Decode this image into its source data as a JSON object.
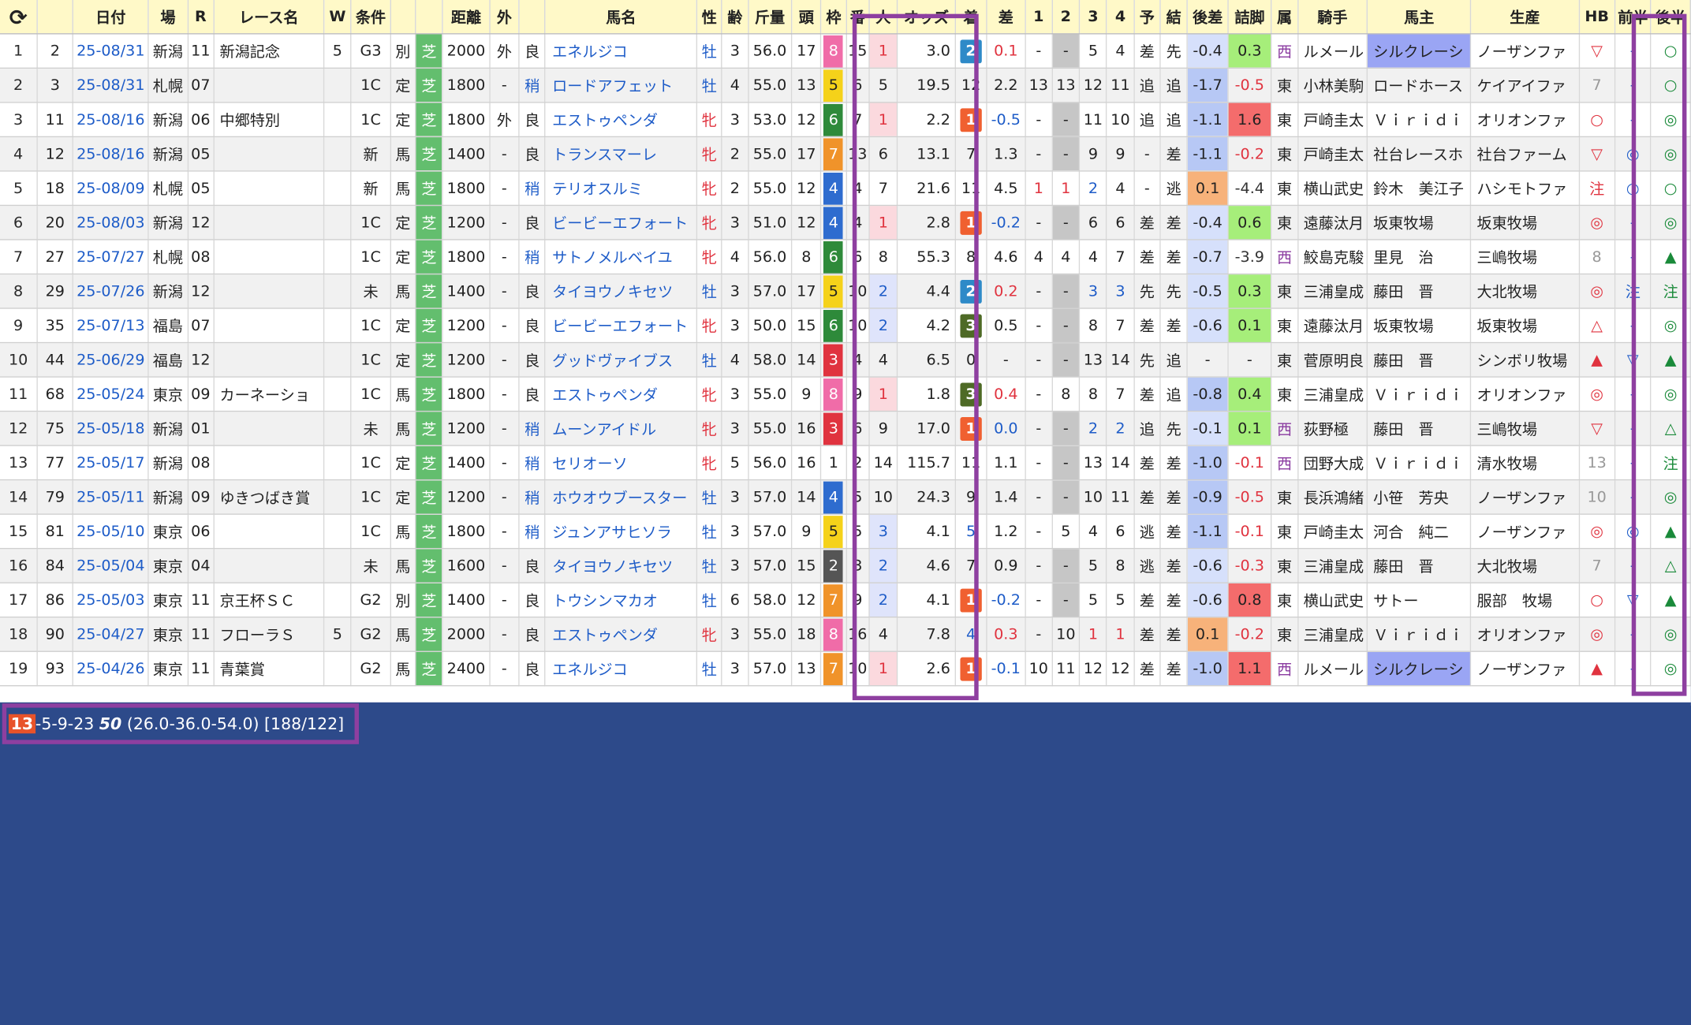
{
  "headers": [
    "⟳",
    "",
    "日付",
    "場",
    "R",
    "レース名",
    "W",
    "条件",
    "",
    "",
    "距離",
    "外",
    "",
    "馬名",
    "性",
    "齢",
    "斤量",
    "頭",
    "枠",
    "番",
    "人",
    "オッズ",
    "着",
    "差",
    "1",
    "2",
    "3",
    "4",
    "予",
    "結",
    "後差",
    "詰脚",
    "属",
    "騎手",
    "馬主",
    "生産",
    "HB",
    "前半",
    "後半"
  ],
  "colors": {
    "header_bg": "#fff9c8",
    "highlight_border": "#8e3fa0",
    "page_bg": "#2d4a8a",
    "turf": "#63be6e",
    "finish1": "#f06030",
    "finish2": "#2e8ac8",
    "finish3": "#4e6a26",
    "owner_highlight": "#9aa5f4"
  },
  "rows": [
    {
      "no": "1",
      "a": "2",
      "date": "25-08/31",
      "venue": "新潟",
      "r": "11",
      "race": "新潟記念",
      "w": "5",
      "cls": "G3",
      "cond": "別",
      "surface": "芝",
      "dist": "2000",
      "out": "外",
      "going": "良",
      "horse": "エネルジコ",
      "sex": "牡",
      "age": "3",
      "wt": "56.0",
      "heads": "17",
      "gate": "8",
      "num": "15",
      "pop": "1",
      "odds": "3.0",
      "fin": "2",
      "diff": "0.1",
      "c1": "-",
      "c2": "-",
      "c3": "5",
      "c4": "4",
      "yo": "差",
      "ke": "先",
      "late": "-0.4",
      "tsume": "0.3",
      "zoku": "西",
      "jockey": "ルメール",
      "owner": "シルクレーシ",
      "breeder": "ノーザンファ",
      "hb": "▽",
      "zen": "-",
      "kou": "○"
    },
    {
      "no": "2",
      "a": "3",
      "date": "25-08/31",
      "venue": "札幌",
      "r": "07",
      "race": "",
      "w": "",
      "cls": "1C",
      "cond": "定",
      "surface": "芝",
      "dist": "1800",
      "out": "-",
      "going": "稍",
      "horse": "ロードアフェット",
      "sex": "牡",
      "age": "4",
      "wt": "55.0",
      "heads": "13",
      "gate": "5",
      "num": "6",
      "pop": "5",
      "odds": "19.5",
      "fin": "12",
      "diff": "2.2",
      "c1": "13",
      "c2": "13",
      "c3": "12",
      "c4": "11",
      "yo": "追",
      "ke": "追",
      "late": "-1.7",
      "tsume": "-0.5",
      "zoku": "東",
      "jockey": "小林美駒",
      "owner": "ロードホース",
      "breeder": "ケイアイファ",
      "hb": "7",
      "zen": "-",
      "kou": "○"
    },
    {
      "no": "3",
      "a": "11",
      "date": "25-08/16",
      "venue": "新潟",
      "r": "06",
      "race": "中郷特別",
      "w": "",
      "cls": "1C",
      "cond": "定",
      "surface": "芝",
      "dist": "1800",
      "out": "外",
      "going": "良",
      "horse": "エストゥペンダ",
      "sex": "牝",
      "age": "3",
      "wt": "53.0",
      "heads": "12",
      "gate": "6",
      "num": "7",
      "pop": "1",
      "odds": "2.2",
      "fin": "1",
      "diff": "-0.5",
      "c1": "-",
      "c2": "-",
      "c3": "11",
      "c4": "10",
      "yo": "追",
      "ke": "追",
      "late": "-1.1",
      "tsume": "1.6",
      "zoku": "東",
      "jockey": "戸崎圭太",
      "owner": "Ｖｉｒｉｄｉ",
      "breeder": "オリオンファ",
      "hb": "○",
      "zen": "-",
      "kou": "◎"
    },
    {
      "no": "4",
      "a": "12",
      "date": "25-08/16",
      "venue": "新潟",
      "r": "05",
      "race": "",
      "w": "",
      "cls": "新",
      "cond": "馬",
      "surface": "芝",
      "dist": "1400",
      "out": "-",
      "going": "良",
      "horse": "トランスマーレ",
      "sex": "牝",
      "age": "2",
      "wt": "55.0",
      "heads": "17",
      "gate": "7",
      "num": "13",
      "pop": "6",
      "odds": "13.1",
      "fin": "7",
      "diff": "1.3",
      "c1": "-",
      "c2": "-",
      "c3": "9",
      "c4": "9",
      "yo": "-",
      "ke": "差",
      "late": "-1.1",
      "tsume": "-0.2",
      "zoku": "東",
      "jockey": "戸崎圭太",
      "owner": "社台レースホ",
      "breeder": "社台ファーム",
      "hb": "▽",
      "zen": "◎",
      "kou": "◎"
    },
    {
      "no": "5",
      "a": "18",
      "date": "25-08/09",
      "venue": "札幌",
      "r": "05",
      "race": "",
      "w": "",
      "cls": "新",
      "cond": "馬",
      "surface": "芝",
      "dist": "1800",
      "out": "-",
      "going": "稍",
      "horse": "テリオスルミ",
      "sex": "牝",
      "age": "2",
      "wt": "55.0",
      "heads": "12",
      "gate": "4",
      "num": "4",
      "pop": "7",
      "odds": "21.6",
      "fin": "11",
      "diff": "4.5",
      "c1": "1",
      "c2": "1",
      "c3": "2",
      "c4": "4",
      "yo": "-",
      "ke": "逃",
      "late": "0.1",
      "tsume": "-4.4",
      "zoku": "東",
      "jockey": "横山武史",
      "owner": "鈴木　美江子",
      "breeder": "ハシモトファ",
      "hb": "注",
      "zen": "○",
      "kou": "○"
    },
    {
      "no": "6",
      "a": "20",
      "date": "25-08/03",
      "venue": "新潟",
      "r": "12",
      "race": "",
      "w": "",
      "cls": "1C",
      "cond": "定",
      "surface": "芝",
      "dist": "1200",
      "out": "-",
      "going": "良",
      "horse": "ビービーエフォート",
      "sex": "牝",
      "age": "3",
      "wt": "51.0",
      "heads": "12",
      "gate": "4",
      "num": "4",
      "pop": "1",
      "odds": "2.8",
      "fin": "1",
      "diff": "-0.2",
      "c1": "-",
      "c2": "-",
      "c3": "6",
      "c4": "6",
      "yo": "差",
      "ke": "差",
      "late": "-0.4",
      "tsume": "0.6",
      "zoku": "東",
      "jockey": "遠藤汰月",
      "owner": "坂東牧場",
      "breeder": "坂東牧場",
      "hb": "◎",
      "zen": "-",
      "kou": "◎"
    },
    {
      "no": "7",
      "a": "27",
      "date": "25-07/27",
      "venue": "札幌",
      "r": "08",
      "race": "",
      "w": "",
      "cls": "1C",
      "cond": "定",
      "surface": "芝",
      "dist": "1800",
      "out": "-",
      "going": "稍",
      "horse": "サトノメルベイユ",
      "sex": "牝",
      "age": "4",
      "wt": "56.0",
      "heads": "8",
      "gate": "6",
      "num": "6",
      "pop": "8",
      "odds": "55.3",
      "fin": "8",
      "diff": "4.6",
      "c1": "4",
      "c2": "4",
      "c3": "4",
      "c4": "7",
      "yo": "差",
      "ke": "差",
      "late": "-0.7",
      "tsume": "-3.9",
      "zoku": "西",
      "jockey": "鮫島克駿",
      "owner": "里見　治",
      "breeder": "三嶋牧場",
      "hb": "8",
      "zen": "-",
      "kou": "▲"
    },
    {
      "no": "8",
      "a": "29",
      "date": "25-07/26",
      "venue": "新潟",
      "r": "12",
      "race": "",
      "w": "",
      "cls": "未",
      "cond": "馬",
      "surface": "芝",
      "dist": "1400",
      "out": "-",
      "going": "良",
      "horse": "タイヨウノキセツ",
      "sex": "牡",
      "age": "3",
      "wt": "57.0",
      "heads": "17",
      "gate": "5",
      "num": "10",
      "pop": "2",
      "odds": "4.4",
      "fin": "2",
      "diff": "0.2",
      "c1": "-",
      "c2": "-",
      "c3": "3",
      "c4": "3",
      "yo": "先",
      "ke": "先",
      "late": "-0.5",
      "tsume": "0.3",
      "zoku": "東",
      "jockey": "三浦皇成",
      "owner": "藤田　晋",
      "breeder": "大北牧場",
      "hb": "◎",
      "zen": "注",
      "kou": "注"
    },
    {
      "no": "9",
      "a": "35",
      "date": "25-07/13",
      "venue": "福島",
      "r": "07",
      "race": "",
      "w": "",
      "cls": "1C",
      "cond": "定",
      "surface": "芝",
      "dist": "1200",
      "out": "-",
      "going": "良",
      "horse": "ビービーエフォート",
      "sex": "牝",
      "age": "3",
      "wt": "50.0",
      "heads": "15",
      "gate": "6",
      "num": "10",
      "pop": "2",
      "odds": "4.2",
      "fin": "3",
      "diff": "0.5",
      "c1": "-",
      "c2": "-",
      "c3": "8",
      "c4": "7",
      "yo": "差",
      "ke": "差",
      "late": "-0.6",
      "tsume": "0.1",
      "zoku": "東",
      "jockey": "遠藤汰月",
      "owner": "坂東牧場",
      "breeder": "坂東牧場",
      "hb": "△",
      "zen": "-",
      "kou": "◎"
    },
    {
      "no": "10",
      "a": "44",
      "date": "25-06/29",
      "venue": "福島",
      "r": "12",
      "race": "",
      "w": "",
      "cls": "1C",
      "cond": "定",
      "surface": "芝",
      "dist": "1200",
      "out": "-",
      "going": "良",
      "horse": "グッドヴァイブス",
      "sex": "牡",
      "age": "4",
      "wt": "58.0",
      "heads": "14",
      "gate": "3",
      "num": "4",
      "pop": "4",
      "odds": "6.5",
      "fin": "0",
      "diff": "-",
      "c1": "-",
      "c2": "-",
      "c3": "13",
      "c4": "14",
      "yo": "先",
      "ke": "追",
      "late": "-",
      "tsume": "-",
      "zoku": "東",
      "jockey": "菅原明良",
      "owner": "藤田　晋",
      "breeder": "シンボリ牧場",
      "hb": "▲",
      "zen": "▽",
      "kou": "▲"
    },
    {
      "no": "11",
      "a": "68",
      "date": "25-05/24",
      "venue": "東京",
      "r": "09",
      "race": "カーネーショ",
      "w": "",
      "cls": "1C",
      "cond": "馬",
      "surface": "芝",
      "dist": "1800",
      "out": "-",
      "going": "良",
      "horse": "エストゥペンダ",
      "sex": "牝",
      "age": "3",
      "wt": "55.0",
      "heads": "9",
      "gate": "8",
      "num": "9",
      "pop": "1",
      "odds": "1.8",
      "fin": "3",
      "diff": "0.4",
      "c1": "-",
      "c2": "8",
      "c3": "8",
      "c4": "7",
      "yo": "差",
      "ke": "追",
      "late": "-0.8",
      "tsume": "0.4",
      "zoku": "東",
      "jockey": "三浦皇成",
      "owner": "Ｖｉｒｉｄｉ",
      "breeder": "オリオンファ",
      "hb": "◎",
      "zen": "-",
      "kou": "◎"
    },
    {
      "no": "12",
      "a": "75",
      "date": "25-05/18",
      "venue": "新潟",
      "r": "01",
      "race": "",
      "w": "",
      "cls": "未",
      "cond": "馬",
      "surface": "芝",
      "dist": "1200",
      "out": "-",
      "going": "稍",
      "horse": "ムーンアイドル",
      "sex": "牝",
      "age": "3",
      "wt": "55.0",
      "heads": "16",
      "gate": "3",
      "num": "6",
      "pop": "9",
      "odds": "17.0",
      "fin": "1",
      "diff": "0.0",
      "c1": "-",
      "c2": "-",
      "c3": "2",
      "c4": "2",
      "yo": "追",
      "ke": "先",
      "late": "-0.1",
      "tsume": "0.1",
      "zoku": "西",
      "jockey": "荻野極",
      "owner": "藤田　晋",
      "breeder": "三嶋牧場",
      "hb": "▽",
      "zen": "-",
      "kou": "△"
    },
    {
      "no": "13",
      "a": "77",
      "date": "25-05/17",
      "venue": "新潟",
      "r": "08",
      "race": "",
      "w": "",
      "cls": "1C",
      "cond": "定",
      "surface": "芝",
      "dist": "1400",
      "out": "-",
      "going": "稍",
      "horse": "セリオーソ",
      "sex": "牝",
      "age": "5",
      "wt": "56.0",
      "heads": "16",
      "gate": "1",
      "num": "2",
      "pop": "14",
      "odds": "115.7",
      "fin": "11",
      "diff": "1.1",
      "c1": "-",
      "c2": "-",
      "c3": "13",
      "c4": "14",
      "yo": "差",
      "ke": "差",
      "late": "-1.0",
      "tsume": "-0.1",
      "zoku": "西",
      "jockey": "団野大成",
      "owner": "Ｖｉｒｉｄｉ",
      "breeder": "清水牧場",
      "hb": "13",
      "zen": "-",
      "kou": "注"
    },
    {
      "no": "14",
      "a": "79",
      "date": "25-05/11",
      "venue": "新潟",
      "r": "09",
      "race": "ゆきつばき賞",
      "w": "",
      "cls": "1C",
      "cond": "定",
      "surface": "芝",
      "dist": "1200",
      "out": "-",
      "going": "稍",
      "horse": "ホウオウブースター",
      "sex": "牡",
      "age": "3",
      "wt": "57.0",
      "heads": "14",
      "gate": "4",
      "num": "5",
      "pop": "10",
      "odds": "24.3",
      "fin": "9",
      "diff": "1.4",
      "c1": "-",
      "c2": "-",
      "c3": "10",
      "c4": "11",
      "yo": "差",
      "ke": "差",
      "late": "-0.9",
      "tsume": "-0.5",
      "zoku": "東",
      "jockey": "長浜鴻緒",
      "owner": "小笹　芳央",
      "breeder": "ノーザンファ",
      "hb": "10",
      "zen": "-",
      "kou": "◎"
    },
    {
      "no": "15",
      "a": "81",
      "date": "25-05/10",
      "venue": "東京",
      "r": "06",
      "race": "",
      "w": "",
      "cls": "1C",
      "cond": "馬",
      "surface": "芝",
      "dist": "1800",
      "out": "-",
      "going": "稍",
      "horse": "ジュンアサヒソラ",
      "sex": "牡",
      "age": "3",
      "wt": "57.0",
      "heads": "9",
      "gate": "5",
      "num": "5",
      "pop": "3",
      "odds": "4.1",
      "fin": "5",
      "diff": "1.2",
      "c1": "-",
      "c2": "5",
      "c3": "4",
      "c4": "6",
      "yo": "逃",
      "ke": "差",
      "late": "-1.1",
      "tsume": "-0.1",
      "zoku": "東",
      "jockey": "戸崎圭太",
      "owner": "河合　純二",
      "breeder": "ノーザンファ",
      "hb": "◎",
      "zen": "◎",
      "kou": "▲"
    },
    {
      "no": "16",
      "a": "84",
      "date": "25-05/04",
      "venue": "東京",
      "r": "04",
      "race": "",
      "w": "",
      "cls": "未",
      "cond": "馬",
      "surface": "芝",
      "dist": "1600",
      "out": "-",
      "going": "良",
      "horse": "タイヨウノキセツ",
      "sex": "牡",
      "age": "3",
      "wt": "57.0",
      "heads": "15",
      "gate": "2",
      "num": "3",
      "pop": "2",
      "odds": "4.6",
      "fin": "7",
      "diff": "0.9",
      "c1": "-",
      "c2": "-",
      "c3": "5",
      "c4": "8",
      "yo": "逃",
      "ke": "差",
      "late": "-0.6",
      "tsume": "-0.3",
      "zoku": "東",
      "jockey": "三浦皇成",
      "owner": "藤田　晋",
      "breeder": "大北牧場",
      "hb": "7",
      "zen": "-",
      "kou": "△"
    },
    {
      "no": "17",
      "a": "86",
      "date": "25-05/03",
      "venue": "東京",
      "r": "11",
      "race": "京王杯ＳＣ",
      "w": "",
      "cls": "G2",
      "cond": "別",
      "surface": "芝",
      "dist": "1400",
      "out": "-",
      "going": "良",
      "horse": "トウシンマカオ",
      "sex": "牡",
      "age": "6",
      "wt": "58.0",
      "heads": "12",
      "gate": "7",
      "num": "9",
      "pop": "2",
      "odds": "4.1",
      "fin": "1",
      "diff": "-0.2",
      "c1": "-",
      "c2": "-",
      "c3": "5",
      "c4": "5",
      "yo": "差",
      "ke": "差",
      "late": "-0.6",
      "tsume": "0.8",
      "zoku": "東",
      "jockey": "横山武史",
      "owner": "サトー",
      "breeder": "服部　牧場",
      "hb": "○",
      "zen": "▽",
      "kou": "▲"
    },
    {
      "no": "18",
      "a": "90",
      "date": "25-04/27",
      "venue": "東京",
      "r": "11",
      "race": "フローラＳ",
      "w": "5",
      "cls": "G2",
      "cond": "馬",
      "surface": "芝",
      "dist": "2000",
      "out": "-",
      "going": "良",
      "horse": "エストゥペンダ",
      "sex": "牝",
      "age": "3",
      "wt": "55.0",
      "heads": "18",
      "gate": "8",
      "num": "16",
      "pop": "4",
      "odds": "7.8",
      "fin": "4",
      "diff": "0.3",
      "c1": "-",
      "c2": "10",
      "c3": "1",
      "c4": "1",
      "yo": "差",
      "ke": "差",
      "late": "0.1",
      "tsume": "-0.2",
      "zoku": "東",
      "jockey": "三浦皇成",
      "owner": "Ｖｉｒｉｄｉ",
      "breeder": "オリオンファ",
      "hb": "◎",
      "zen": "-",
      "kou": "◎"
    },
    {
      "no": "19",
      "a": "93",
      "date": "25-04/26",
      "venue": "東京",
      "r": "11",
      "race": "青葉賞",
      "w": "",
      "cls": "G2",
      "cond": "馬",
      "surface": "芝",
      "dist": "2400",
      "out": "-",
      "going": "良",
      "horse": "エネルジコ",
      "sex": "牡",
      "age": "3",
      "wt": "57.0",
      "heads": "13",
      "gate": "7",
      "num": "10",
      "pop": "1",
      "odds": "2.6",
      "fin": "1",
      "diff": "-0.1",
      "c1": "10",
      "c2": "11",
      "c3": "12",
      "c4": "12",
      "yo": "差",
      "ke": "差",
      "late": "-1.0",
      "tsume": "1.1",
      "zoku": "西",
      "jockey": "ルメール",
      "owner": "シルクレーシ",
      "breeder": "ノーザンファ",
      "hb": "▲",
      "zen": "-",
      "kou": "◎"
    }
  ],
  "status": {
    "first": "13",
    "rest": "-5-9-23 ",
    "bold": "50",
    "tail": " (26.0-36.0-54.0) [188/122]"
  }
}
